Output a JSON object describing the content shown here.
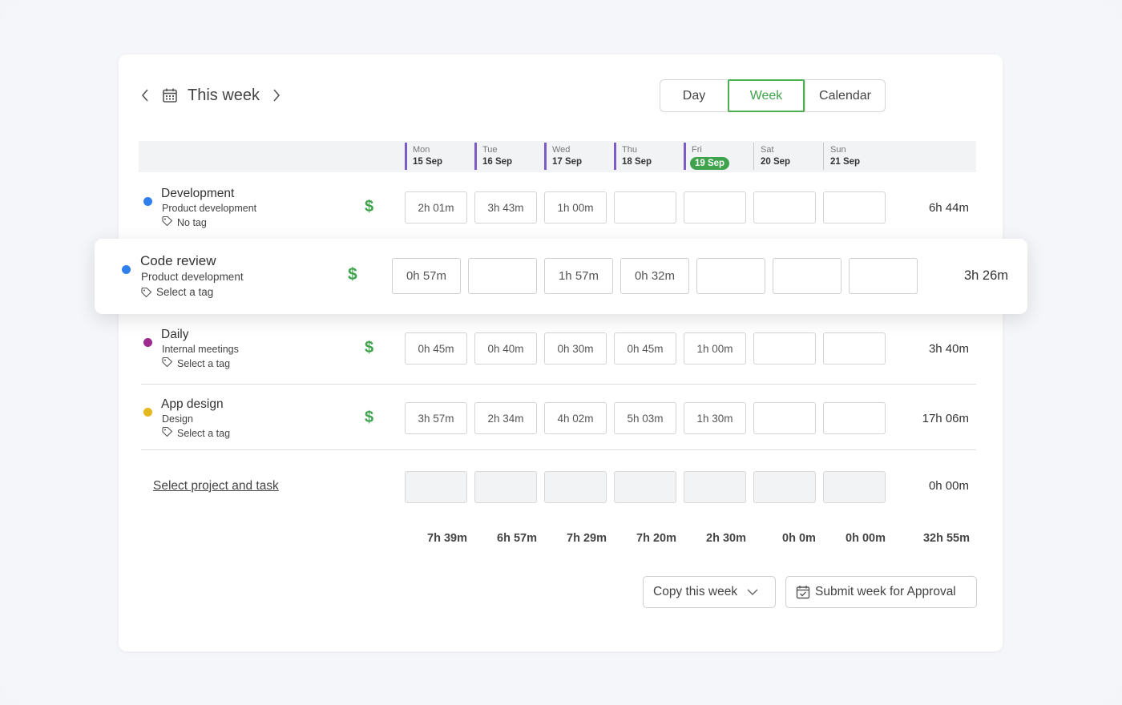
{
  "header": {
    "title": "This week",
    "views": [
      "Day",
      "Week",
      "Calendar"
    ],
    "active_view": "Week"
  },
  "days": [
    {
      "name": "Mon",
      "date": "15 Sep"
    },
    {
      "name": "Tue",
      "date": "16 Sep"
    },
    {
      "name": "Wed",
      "date": "17 Sep"
    },
    {
      "name": "Thu",
      "date": "18 Sep"
    },
    {
      "name": "Fri",
      "date": "19 Sep",
      "today": true
    },
    {
      "name": "Sat",
      "date": "20 Sep"
    },
    {
      "name": "Sun",
      "date": "21 Sep"
    }
  ],
  "billable_symbol": "$",
  "rows": [
    {
      "project": "Development",
      "client": "Product development",
      "tag": "No tag",
      "color": "#2f80ed",
      "entries": [
        "2h 01m",
        "3h 43m",
        "1h 00m",
        "",
        "",
        "",
        ""
      ],
      "total": "6h 44m"
    },
    {
      "project": "Code review",
      "client": "Product development",
      "tag": "Select a tag",
      "color": "#2f80ed",
      "entries": [
        "0h 57m",
        "",
        "1h 57m",
        "0h 32m",
        "",
        "",
        ""
      ],
      "total": "3h 26m"
    },
    {
      "project": "Daily",
      "client": "Internal meetings",
      "tag": "Select a tag",
      "color": "#9c2a8f",
      "entries": [
        "0h 45m",
        "0h 40m",
        "0h 30m",
        "0h 45m",
        "1h 00m",
        "",
        ""
      ],
      "total": "3h 40m"
    },
    {
      "project": "App design",
      "client": "Design",
      "tag": "Select a tag",
      "color": "#e6b820",
      "entries": [
        "3h 57m",
        "2h 34m",
        "4h 02m",
        "5h 03m",
        "1h 30m",
        "",
        ""
      ],
      "total": "17h 06m"
    }
  ],
  "new_row": {
    "label": "Select project and task",
    "total": "0h 00m"
  },
  "day_totals": [
    "7h 39m",
    "6h 57m",
    "7h 29m",
    "7h 20m",
    "2h 30m",
    "0h 0m",
    "0h 00m"
  ],
  "grand_total": "32h 55m",
  "actions": {
    "copy": "Copy this week",
    "submit": "Submit week for Approval"
  },
  "colors": {
    "accent": "#3fa34d",
    "day_marker": "#7b5cc4"
  }
}
